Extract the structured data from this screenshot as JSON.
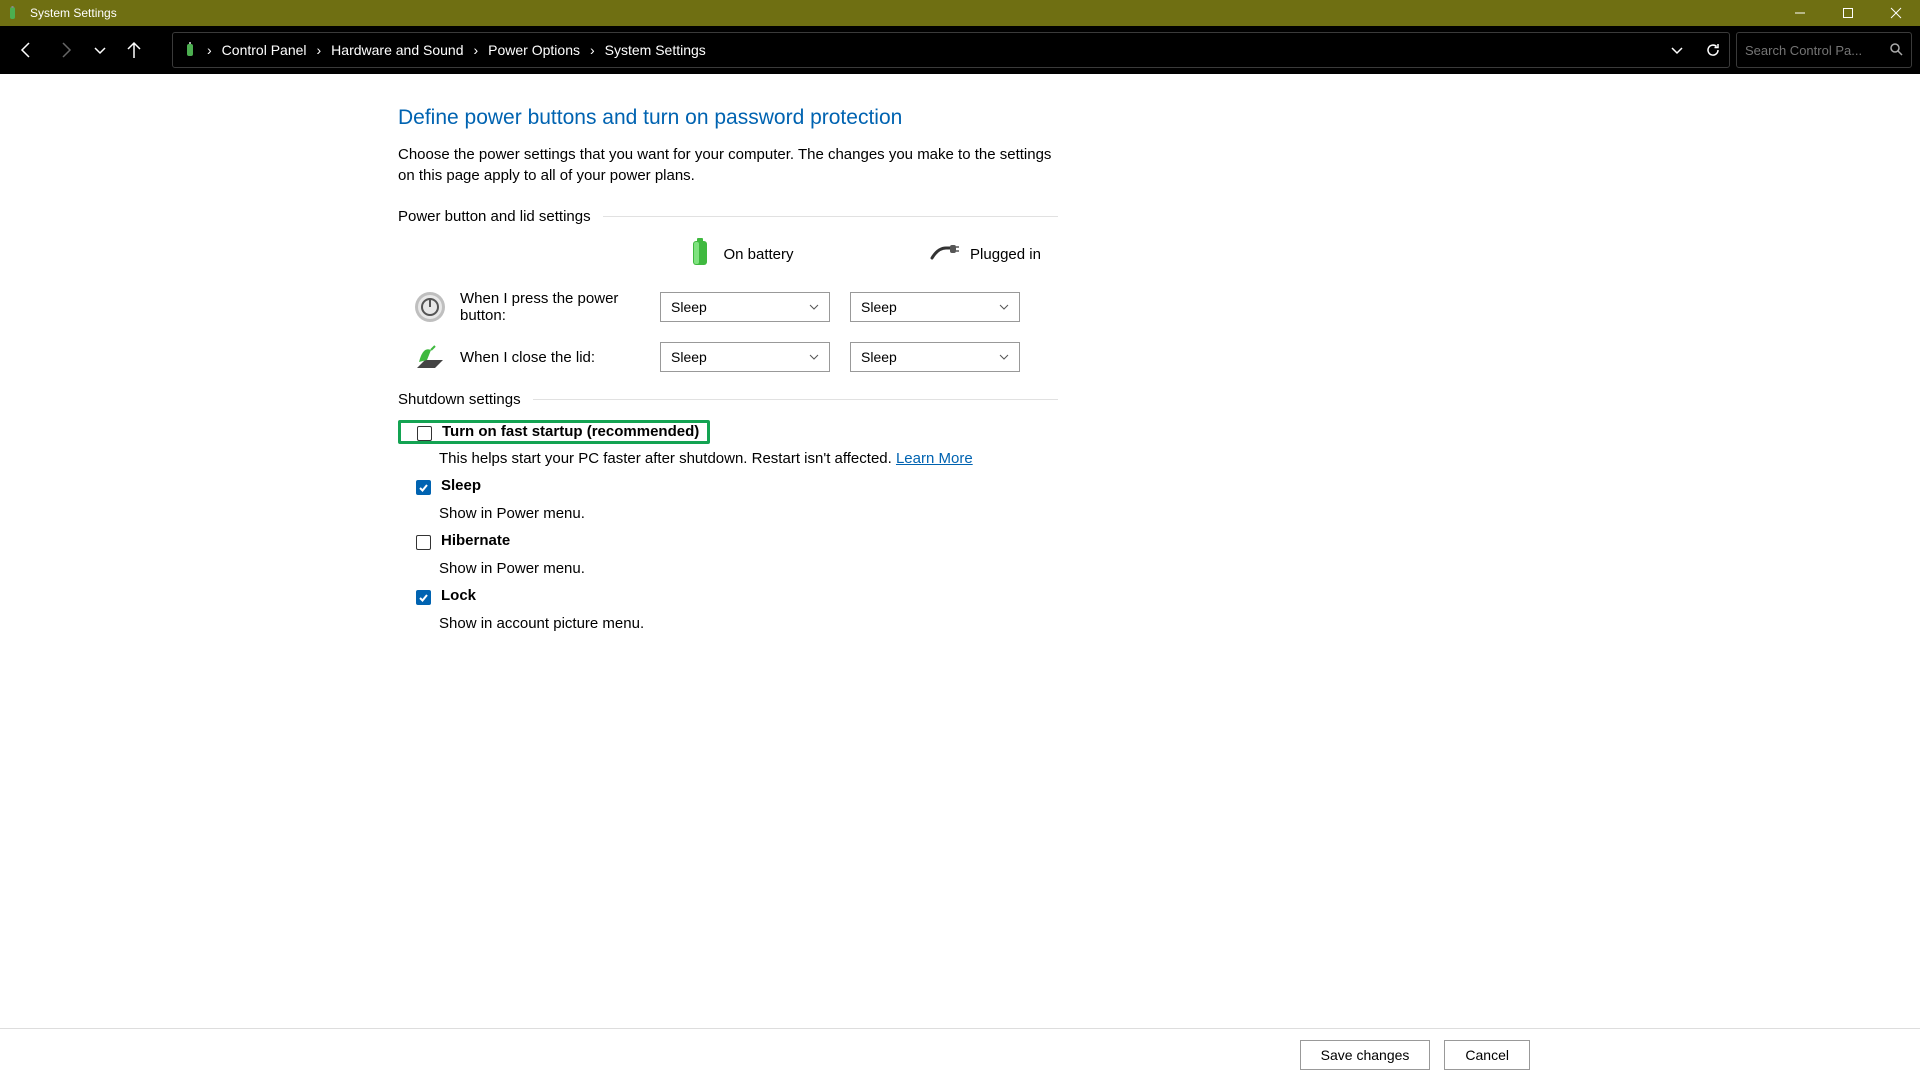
{
  "window": {
    "title": "System Settings"
  },
  "breadcrumb": {
    "items": [
      "Control Panel",
      "Hardware and Sound",
      "Power Options",
      "System Settings"
    ]
  },
  "search": {
    "placeholder": "Search Control Pa..."
  },
  "page": {
    "title": "Define power buttons and turn on password protection",
    "description": "Choose the power settings that you want for your computer. The changes you make to the settings on this page apply to all of your power plans."
  },
  "section_power_lid": {
    "header": "Power button and lid settings",
    "cols": {
      "battery": "On battery",
      "plugged": "Plugged in"
    },
    "rows": [
      {
        "label": "When I press the power button:",
        "battery_value": "Sleep",
        "plugged_value": "Sleep"
      },
      {
        "label": "When I close the lid:",
        "battery_value": "Sleep",
        "plugged_value": "Sleep"
      }
    ]
  },
  "section_shutdown": {
    "header": "Shutdown settings",
    "items": [
      {
        "label": "Turn on fast startup (recommended)",
        "desc": "This helps start your PC faster after shutdown. Restart isn't affected. ",
        "link": "Learn More",
        "checked": false,
        "highlighted": true
      },
      {
        "label": "Sleep",
        "desc": "Show in Power menu.",
        "checked": true,
        "highlighted": false
      },
      {
        "label": "Hibernate",
        "desc": "Show in Power menu.",
        "checked": false,
        "highlighted": false
      },
      {
        "label": "Lock",
        "desc": "Show in account picture menu.",
        "checked": true,
        "highlighted": false
      }
    ]
  },
  "footer": {
    "save": "Save changes",
    "cancel": "Cancel"
  }
}
